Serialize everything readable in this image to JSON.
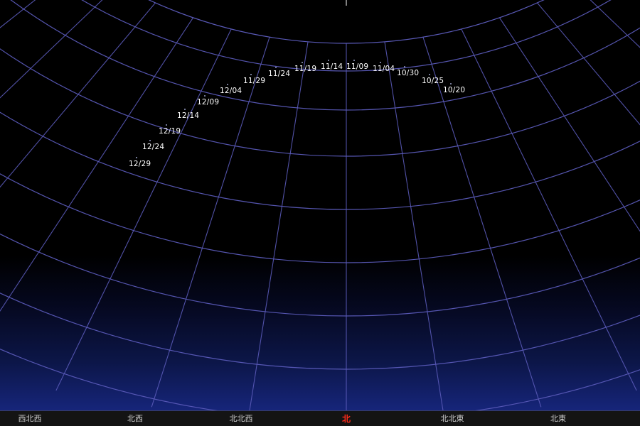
{
  "sky_view": {
    "grid_color": "#5a5ab8",
    "north_color": "#ff2a1a",
    "date_labels": [
      "10/20",
      "10/25",
      "10/30",
      "11/04",
      "11/09",
      "11/14",
      "11/19",
      "11/24",
      "11/29",
      "12/04",
      "12/09",
      "12/14",
      "12/19",
      "12/24",
      "12/29"
    ]
  },
  "horizon": {
    "directions": [
      "西北西",
      "北西",
      "北北西",
      "北",
      "北北東",
      "北東"
    ],
    "north_label": "北"
  }
}
